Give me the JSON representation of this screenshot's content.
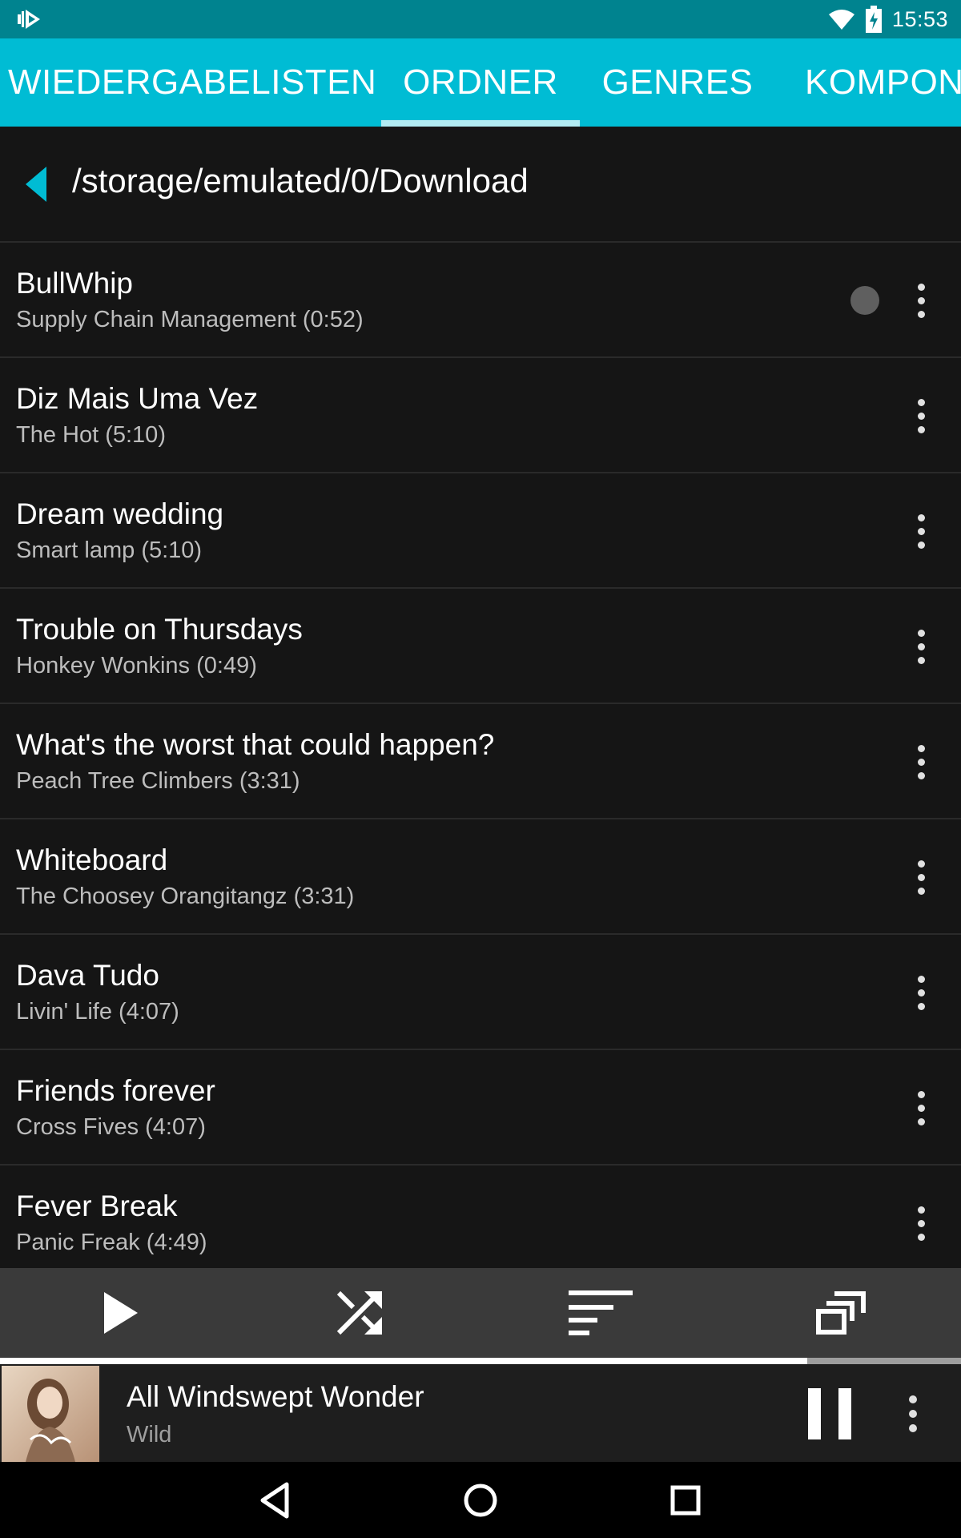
{
  "status_bar": {
    "time": "15:53",
    "icons": [
      "app-notification-icon",
      "wifi-icon",
      "battery-charging-icon"
    ]
  },
  "tabs": [
    {
      "label": "WIEDERGABELISTEN",
      "selected": false
    },
    {
      "label": "ORDNER",
      "selected": true
    },
    {
      "label": "GENRES",
      "selected": false
    },
    {
      "label": "KOMPON",
      "selected": false
    }
  ],
  "folder": {
    "path": "/storage/emulated/0/Download",
    "back_icon": "back-triangle-icon"
  },
  "tracks": [
    {
      "title": "BullWhip",
      "subtitle": "Supply Chain Management (0:52)",
      "playing_indicator": true
    },
    {
      "title": "Diz Mais Uma Vez",
      "subtitle": "The Hot (5:10)"
    },
    {
      "title": "Dream wedding",
      "subtitle": "Smart lamp (5:10)"
    },
    {
      "title": "Trouble on Thursdays",
      "subtitle": "Honkey Wonkins (0:49)"
    },
    {
      "title": "What's the worst that could happen?",
      "subtitle": "Peach Tree Climbers (3:31)"
    },
    {
      "title": "Whiteboard",
      "subtitle": "The Choosey Orangitangz (3:31)"
    },
    {
      "title": "Dava Tudo",
      "subtitle": "Livin' Life (4:07)"
    },
    {
      "title": "Friends forever",
      "subtitle": "Cross Fives (4:07)"
    },
    {
      "title": "Fever Break",
      "subtitle": "Panic Freak (4:49)"
    }
  ],
  "toolbar": {
    "icons": [
      "play-icon",
      "shuffle-icon",
      "sort-icon",
      "queue-icon"
    ]
  },
  "now_playing": {
    "song": "All Windswept Wonder",
    "artist": "Wild",
    "progress_fraction": 0.84,
    "cover_icon": "album-cover-image"
  },
  "colors": {
    "accent": "#00bcd4",
    "status_bar": "#00838f",
    "background": "#151515",
    "toolbar": "#3a3a3a",
    "tab_indicator": "#b2ebf2"
  },
  "nav_bar": {
    "icons": [
      "back-icon",
      "home-icon",
      "recents-icon"
    ]
  }
}
